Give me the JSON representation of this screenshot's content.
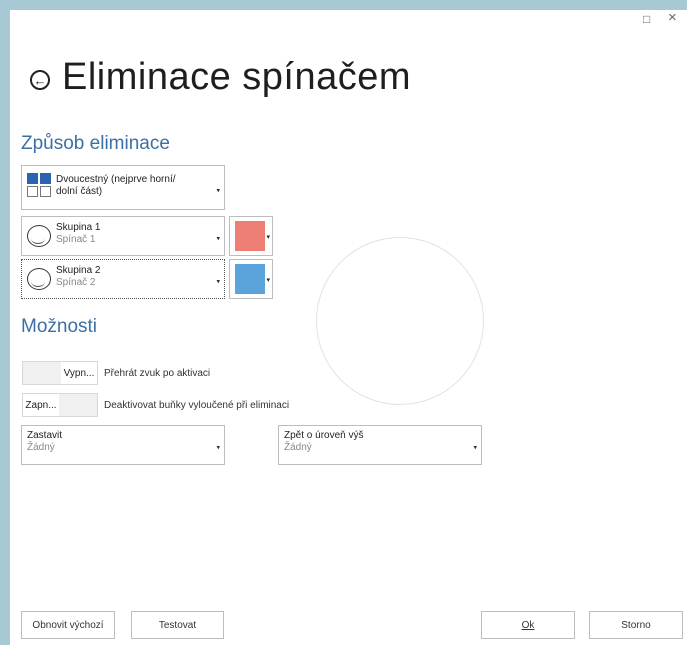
{
  "window": {
    "maximize_icon": "□",
    "close_icon": "×"
  },
  "header": {
    "back_icon": "←",
    "title": "Eliminace spínačem"
  },
  "sections": {
    "method_title": "Způsob eliminace",
    "options_title": "Možnosti"
  },
  "method": {
    "label_line1": "Dvoucestný (nejprve horní/",
    "label_line2": "dolní část)"
  },
  "groups": [
    {
      "name": "Skupina 1",
      "switch": "Spínač 1",
      "color": "#ee7f74"
    },
    {
      "name": "Skupina 2",
      "switch": "Spínač 2",
      "color": "#5aa4db"
    }
  ],
  "options": {
    "sound_toggle_state": "Vypn...",
    "sound_label": "Přehrát zvuk po aktivaci",
    "deactivate_toggle_state": "Zapn...",
    "deactivate_label": "Deaktivovat buňky vyloučené při eliminaci"
  },
  "stop": {
    "title": "Zastavit",
    "value": "Žádný"
  },
  "up_level": {
    "title": "Zpět o úroveň výš",
    "value": "Žádný"
  },
  "buttons": {
    "reset": "Obnovit výchozí",
    "test": "Testovat",
    "ok": "Ok",
    "cancel": "Storno"
  }
}
